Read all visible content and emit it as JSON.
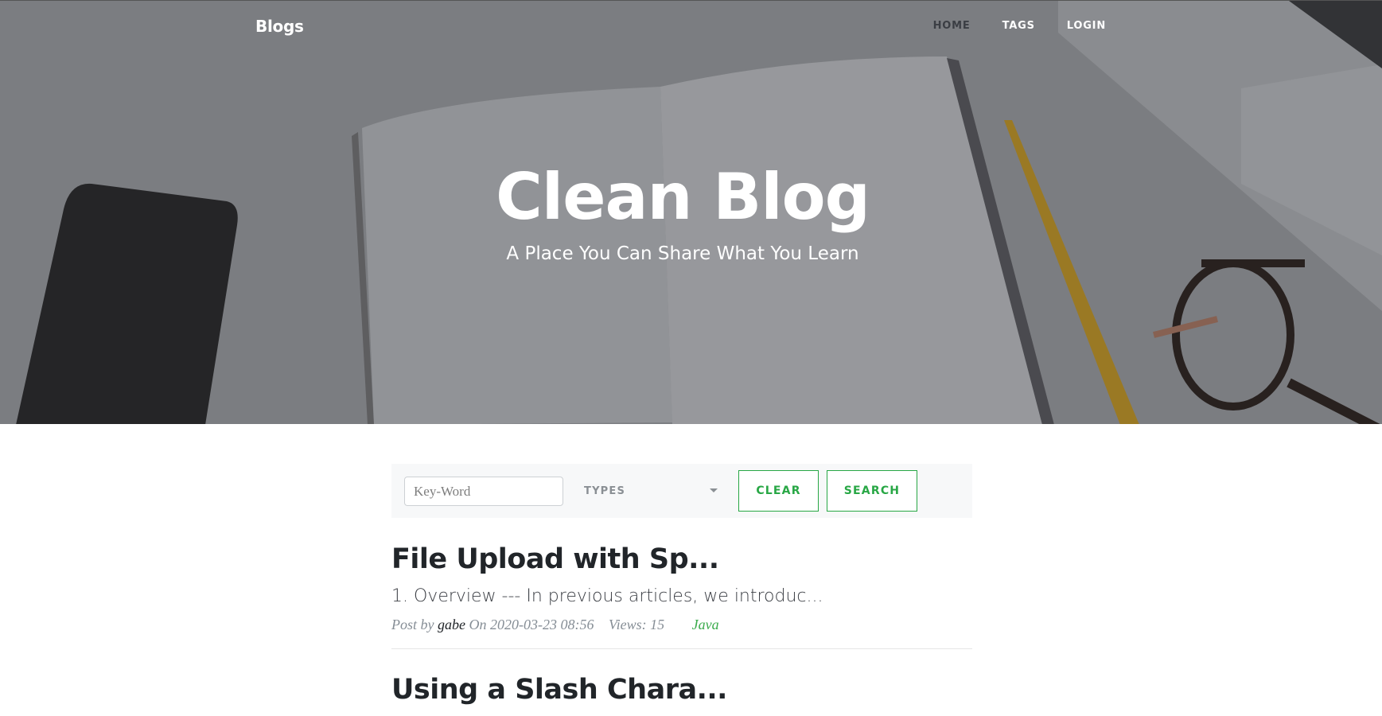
{
  "header": {
    "brand": "Blogs",
    "nav": [
      "HOME",
      "TAGS",
      "LOGIN"
    ]
  },
  "hero": {
    "title": "Clean Blog",
    "subtitle": "A Place You Can Share What You Learn"
  },
  "search": {
    "placeholder": "Key-Word",
    "types_label": "TYPES",
    "clear_label": "CLEAR",
    "search_label": "SEARCH"
  },
  "posts": [
    {
      "title": "File Upload with Sp...",
      "excerpt": "1. Overview --- In previous articles, we introduc...",
      "meta_prefix": "Post by",
      "author": "gabe",
      "meta_on": "On 2020-03-23 08:56",
      "views": "Views: 15",
      "tag": "Java"
    },
    {
      "title": "Using a Slash Chara..."
    }
  ],
  "colors": {
    "accent": "#28a745",
    "text_dark": "#212529",
    "muted": "#868e96"
  }
}
